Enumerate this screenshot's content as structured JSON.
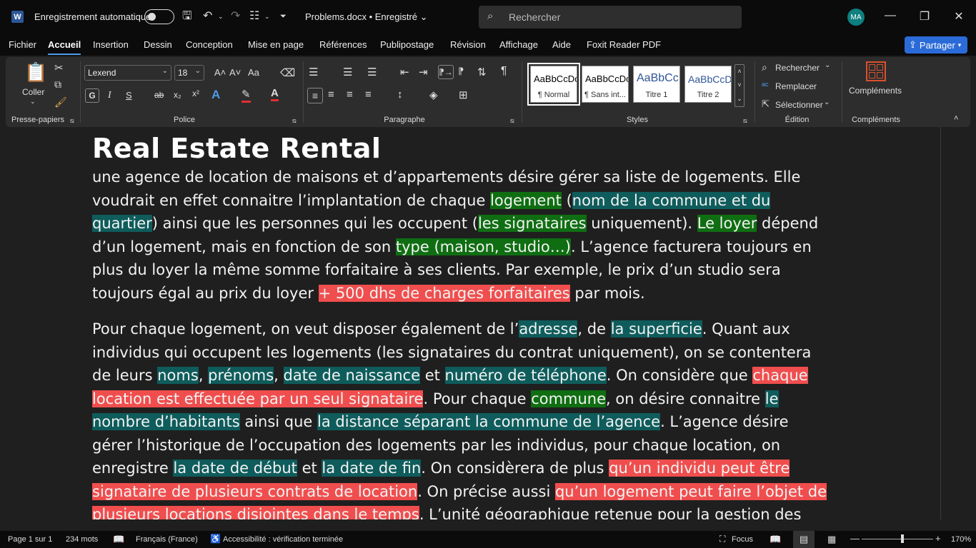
{
  "titlebar": {
    "app_icon": "W",
    "autosave_label": "Enregistrement automatique",
    "doc_title": "Problems.docx • Enregistré ⌄",
    "search_placeholder": "Rechercher",
    "avatar": "MA"
  },
  "tabs": [
    "Fichier",
    "Accueil",
    "Insertion",
    "Dessin",
    "Conception",
    "Mise en page",
    "Références",
    "Publipostage",
    "Révision",
    "Affichage",
    "Aide",
    "Foxit Reader PDF"
  ],
  "share_label": "Partager",
  "ribbon": {
    "clipboard": {
      "paste": "Coller",
      "group": "Presse-papiers"
    },
    "font": {
      "name": "Lexend",
      "size": "18",
      "group": "Police",
      "bold": "G",
      "italic": "I",
      "underline": "S",
      "strike": "ab",
      "sub": "x₂",
      "sup": "x²",
      "case": "Aa",
      "grow": "A˄",
      "shrink": "A˅"
    },
    "paragraph": {
      "group": "Paragraphe"
    },
    "styles": {
      "group": "Styles",
      "items": [
        {
          "sample": "AaBbCcDc",
          "name": "¶ Normal"
        },
        {
          "sample": "AaBbCcDc",
          "name": "¶ Sans int..."
        },
        {
          "sample": "AaBbCc",
          "name": "Titre 1"
        },
        {
          "sample": "AaBbCcD",
          "name": "Titre 2"
        }
      ]
    },
    "editing": {
      "group": "Édition",
      "find": "Rechercher",
      "replace": "Remplacer",
      "select": "Sélectionner"
    },
    "addins": {
      "group": "Compléments",
      "label": "Compléments"
    }
  },
  "document": {
    "title": "Real Estate Rental",
    "p1": [
      {
        "t": "une agence de location de maisons et d’appartements désire gérer sa liste de logements. Elle voudrait en effet connaitre l’implantation de chaque ",
        "h": ""
      },
      {
        "t": "logement",
        "h": "g"
      },
      {
        "t": " (",
        "h": ""
      },
      {
        "t": "nom de la commune et du quartier",
        "h": "t"
      },
      {
        "t": ") ainsi que les personnes qui les occupent (",
        "h": ""
      },
      {
        "t": "les signataires",
        "h": "g"
      },
      {
        "t": " uniquement). ",
        "h": ""
      },
      {
        "t": "Le loyer",
        "h": "g"
      },
      {
        "t": " dépend d’un logement, mais en fonction de son ",
        "h": ""
      },
      {
        "t": "type (maison, studio…)",
        "h": "g"
      },
      {
        "t": ". L’agence facturera toujours en plus du loyer la même somme forfaitaire à ses clients. Par exemple, le prix d’un studio sera toujours égal au prix du loyer ",
        "h": ""
      },
      {
        "t": "+ 500 dhs de charges forfaitaires",
        "h": "r"
      },
      {
        "t": " par mois.",
        "h": ""
      }
    ],
    "p2": [
      {
        "t": "Pour chaque logement, on veut disposer également de l’",
        "h": ""
      },
      {
        "t": "adresse",
        "h": "t"
      },
      {
        "t": ", de ",
        "h": ""
      },
      {
        "t": "la superficie",
        "h": "t"
      },
      {
        "t": ". Quant aux individus qui occupent les logements (les signataires du contrat uniquement), on se contentera de leurs ",
        "h": ""
      },
      {
        "t": "noms",
        "h": "t"
      },
      {
        "t": ", ",
        "h": ""
      },
      {
        "t": "prénoms",
        "h": "t"
      },
      {
        "t": ", ",
        "h": ""
      },
      {
        "t": "date de naissance",
        "h": "t"
      },
      {
        "t": " et ",
        "h": ""
      },
      {
        "t": "numéro de téléphone",
        "h": "t"
      },
      {
        "t": ". On considère que ",
        "h": ""
      },
      {
        "t": "chaque location est effectuée par un seul signataire",
        "h": "r"
      },
      {
        "t": ". Pour chaque ",
        "h": ""
      },
      {
        "t": "commune",
        "h": "g"
      },
      {
        "t": ", on désire connaitre ",
        "h": ""
      },
      {
        "t": "le nombre d’habitants",
        "h": "t"
      },
      {
        "t": " ainsi que ",
        "h": ""
      },
      {
        "t": "la distance séparant la commune de l’agence",
        "h": "t"
      },
      {
        "t": ". L’agence désire gérer l’historique de l’occupation des logements par les individus, pour chaque location, on enregistre ",
        "h": ""
      },
      {
        "t": "la date de début",
        "h": "t"
      },
      {
        "t": " et ",
        "h": ""
      },
      {
        "t": "la date de fin",
        "h": "t"
      },
      {
        "t": ". On considèrera de plus ",
        "h": ""
      },
      {
        "t": "qu’un individu peut être signataire de plusieurs contrats de location",
        "h": "r"
      },
      {
        "t": ". On précise aussi ",
        "h": ""
      },
      {
        "t": "qu’un logement peut faire l’objet de plusieurs locations disjointes dans le temps",
        "h": "r"
      },
      {
        "t": ". L’unité géographique retenue pour la gestion des",
        "h": ""
      }
    ]
  },
  "statusbar": {
    "page": "Page 1 sur 1",
    "words": "234 mots",
    "language": "Français (France)",
    "accessibility": "Accessibilité : vérification terminée",
    "focus": "Focus",
    "zoom": "170%"
  },
  "colors": {
    "highlight_green": "#0f6e12",
    "highlight_teal": "#0f5c5c",
    "highlight_red": "#f04e4e",
    "accent": "#2b6bd8"
  }
}
